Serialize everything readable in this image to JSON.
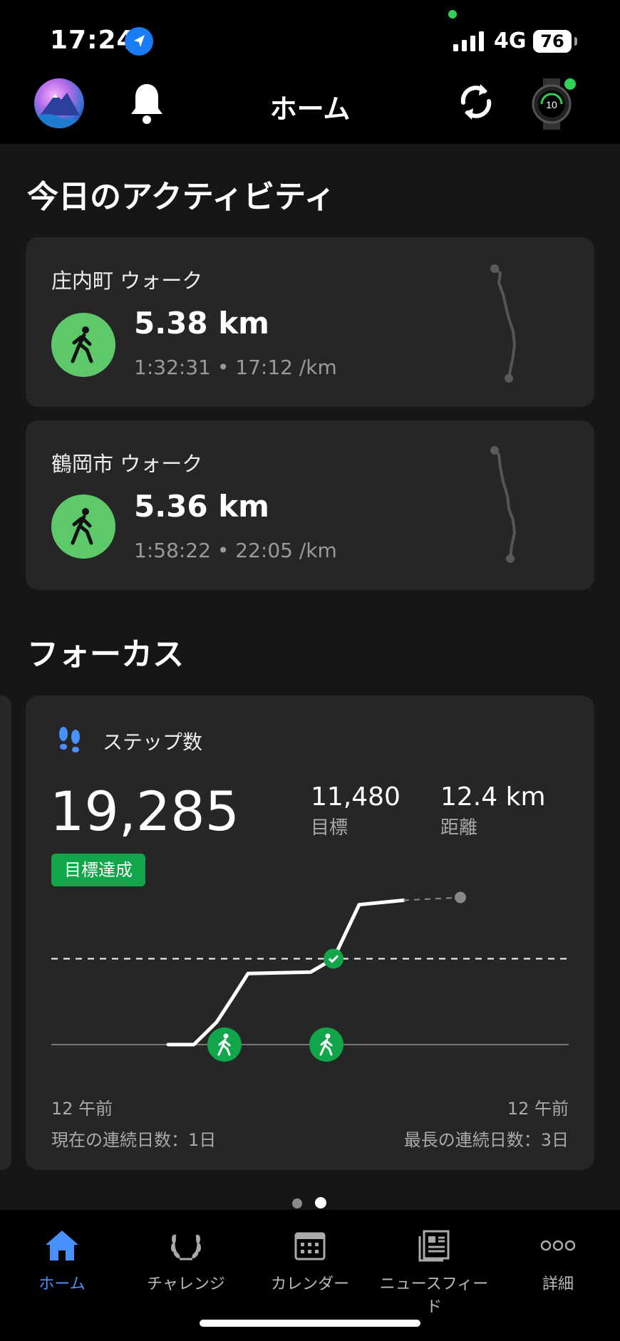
{
  "status_bar": {
    "time": "17:24",
    "network": "4G",
    "battery": "76"
  },
  "header": {
    "title": "ホーム",
    "avatar_icon": "avatar",
    "bell_icon": "bell-icon",
    "sync_icon": "sync-icon",
    "watch_icon": "watch-icon",
    "watch_face_value": "10"
  },
  "today": {
    "section_title": "今日のアクティビティ",
    "activities": [
      {
        "title": "庄内町 ウォーク",
        "distance": "5.38 km",
        "meta": "1:32:31 • 17:12 /km"
      },
      {
        "title": "鶴岡市 ウォーク",
        "distance": "5.36 km",
        "meta": "1:58:22 • 22:05 /km"
      }
    ]
  },
  "focus": {
    "section_title": "フォーカス",
    "steps": {
      "label": "ステップ数",
      "value": "19,285",
      "goal_value": "11,480",
      "goal_label": "目標",
      "distance_value": "12.4 km",
      "distance_label": "距離",
      "badge": "目標達成",
      "axis_start": "12 午前",
      "axis_end": "12 午前",
      "current_streak": "現在の連続日数：1日",
      "longest_streak": "最長の連続日数：3日"
    }
  },
  "chart_data": {
    "type": "line",
    "series": [
      {
        "values": [
          0,
          0,
          0,
          3000,
          6500,
          9500,
          9700,
          11480,
          18700,
          19285,
          19285
        ]
      }
    ],
    "goal": 11480,
    "ylim": [
      0,
      20000
    ]
  },
  "pager": {
    "count": 2,
    "active": 1
  },
  "tabs": [
    {
      "label": "ホーム",
      "icon": "home-icon",
      "active": true
    },
    {
      "label": "チャレンジ",
      "icon": "laurel-icon",
      "active": false
    },
    {
      "label": "カレンダー",
      "icon": "calendar-icon",
      "active": false
    },
    {
      "label": "ニュースフィード",
      "icon": "newsfeed-icon",
      "active": false
    },
    {
      "label": "詳細",
      "icon": "more-icon",
      "active": false
    }
  ],
  "colors": {
    "accent": "#4a90ff",
    "activity_green": "#5ec96a",
    "goal_green": "#12a64a"
  }
}
